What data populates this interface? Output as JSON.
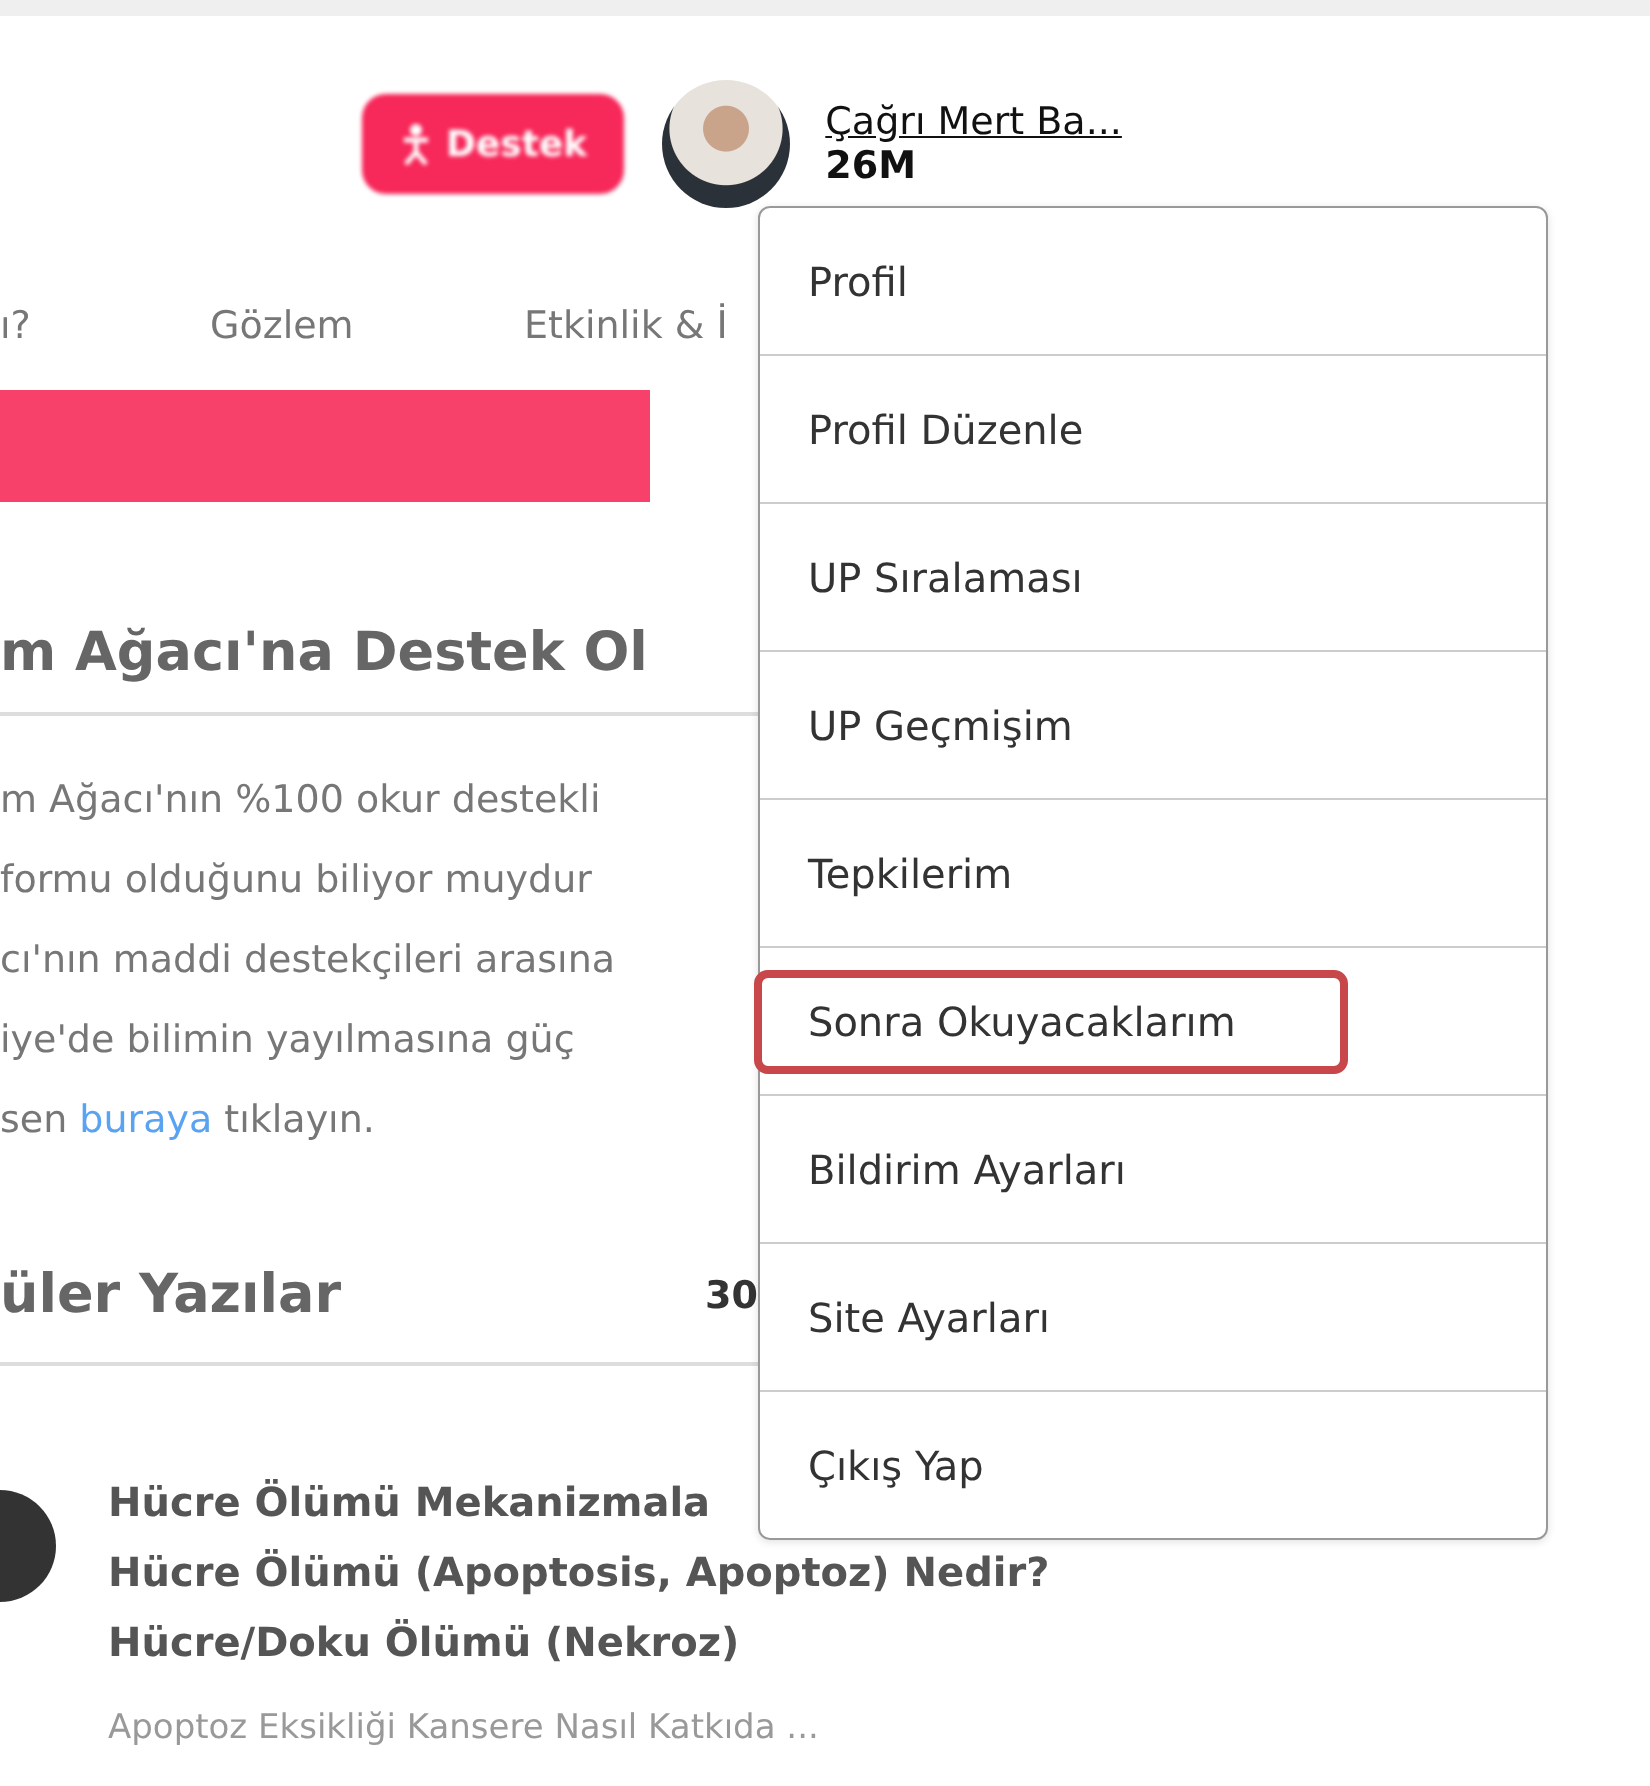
{
  "header": {
    "support_button": "Destek",
    "user": {
      "name": "Çağrı Mert Ba...",
      "points": "26M"
    }
  },
  "nav": [
    "ı?",
    "Gözlem",
    "Etkinlik & İ"
  ],
  "support_section": {
    "heading": "m Ağacı'na Destek Ol",
    "lines": [
      "m Ağacı'nın %100 okur destekli",
      "formu olduğunu biliyor muydur",
      "cı'nın maddi destekçileri arasına",
      "iye'de bilimin yayılmasına güç"
    ],
    "last_line": {
      "before": "sen ",
      "link": "buraya",
      "after": " tıklayın."
    }
  },
  "popular": {
    "heading": "üler Yazılar",
    "tab": "30",
    "article": {
      "titles": [
        "Hücre Ölümü Mekanizmala",
        "Hücre Ölümü (Apoptosis, Apoptoz) Nedir?",
        "Hücre/Doku Ölümü (Nekroz)"
      ],
      "subtitle": "Apoptoz Eksikliği Kansere Nasıl Katkıda ..."
    }
  },
  "user_menu": [
    {
      "label": "Profil",
      "selected": false
    },
    {
      "label": "Profil Düzenle",
      "selected": false
    },
    {
      "label": "UP Sıralaması",
      "selected": false
    },
    {
      "label": "UP Geçmişim",
      "selected": false
    },
    {
      "label": "Tepkilerim",
      "selected": false
    },
    {
      "label": "Sonra Okuyacaklarım",
      "selected": true
    },
    {
      "label": "Bildirim Ayarları",
      "selected": false
    },
    {
      "label": "Site Ayarları",
      "selected": false
    },
    {
      "label": "Çıkış Yap",
      "selected": false
    }
  ]
}
